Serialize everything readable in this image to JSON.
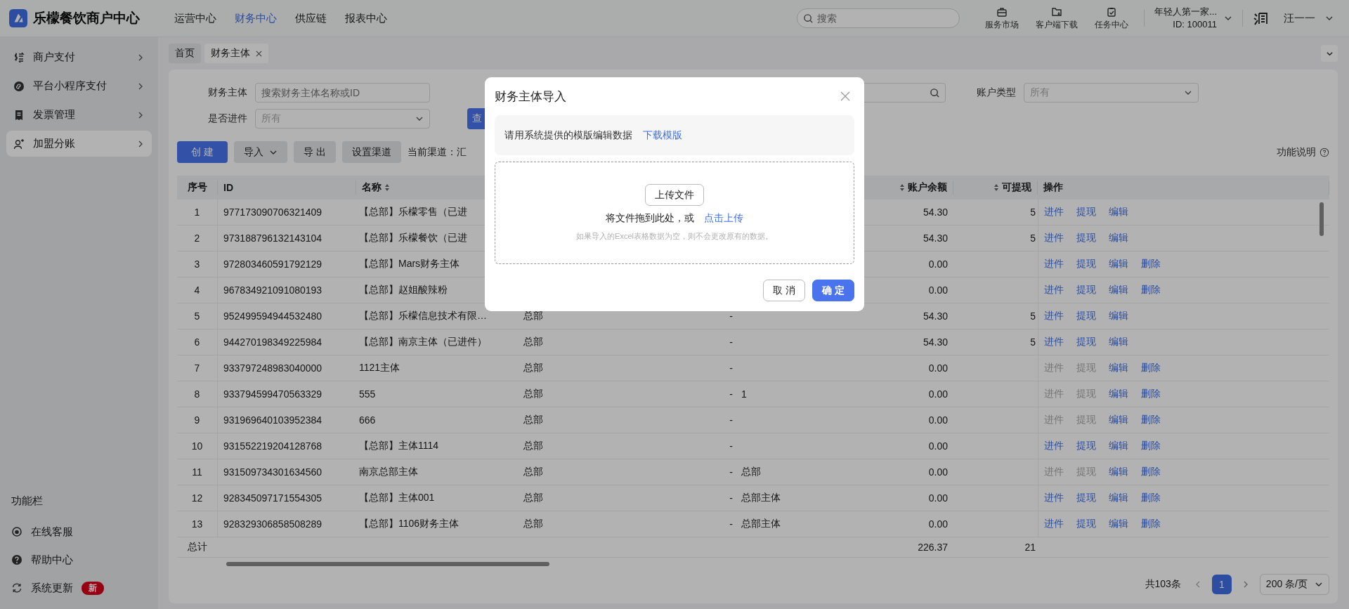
{
  "app": {
    "title": "乐檬餐饮商户中心"
  },
  "nav": [
    {
      "label": "运营中心",
      "selected": false
    },
    {
      "label": "财务中心",
      "selected": true
    },
    {
      "label": "供应链",
      "selected": false
    },
    {
      "label": "报表中心",
      "selected": false
    }
  ],
  "search": {
    "placeholder": "搜索"
  },
  "tools": [
    {
      "label": "服务市场",
      "kind": "shop"
    },
    {
      "label": "客户端下载",
      "kind": "download"
    },
    {
      "label": "任务中心",
      "kind": "task"
    }
  ],
  "account": {
    "name": "年轻人第一家...",
    "id": "ID: 100011"
  },
  "user": {
    "name": "汪一一"
  },
  "sidebar": {
    "items": [
      {
        "label": "商户支付",
        "kind": "exchange",
        "selected": false
      },
      {
        "label": "平台小程序支付",
        "kind": "miniapp",
        "selected": false
      },
      {
        "label": "发票管理",
        "kind": "invoice",
        "selected": false
      },
      {
        "label": "加盟分账",
        "kind": "person",
        "selected": true
      }
    ],
    "section_title": "功能栏",
    "footer_items": [
      {
        "label": "在线客服",
        "kind": "service"
      },
      {
        "label": "帮助中心",
        "kind": "help"
      },
      {
        "label": "系统更新",
        "kind": "update",
        "badge": "新"
      }
    ]
  },
  "tabs": [
    {
      "label": "首页",
      "selected": false,
      "closable": false
    },
    {
      "label": "财务主体",
      "selected": true,
      "closable": true
    }
  ],
  "filter_rows": [
    [
      {
        "label": "财务主体",
        "kind": "input",
        "placeholder": "搜索财务主体名称或ID"
      },
      {
        "kind": "search"
      },
      {
        "label": "账户类型",
        "kind": "select",
        "placeholder": "所有"
      }
    ],
    [
      {
        "label": "是否进件",
        "kind": "select",
        "placeholder": "所有"
      }
    ]
  ],
  "query_button": {
    "label": "查"
  },
  "toolbar": {
    "buttons": [
      {
        "label": "创 建",
        "kind": "primary"
      },
      {
        "label": "导入",
        "kind": "dropdown"
      },
      {
        "label": "导 出",
        "kind": "default"
      },
      {
        "label": "设置渠道",
        "kind": "default"
      }
    ],
    "channel": "当前渠道：汇",
    "help": "功能说明"
  },
  "table": {
    "columns": [
      {
        "label": "序号",
        "sortable": false
      },
      {
        "label": "ID",
        "sortable": false
      },
      {
        "label": "名称",
        "sortable": true
      },
      {
        "label": "账户余额",
        "sortable": true
      },
      {
        "label": "可提现",
        "sortable": true
      },
      {
        "label": "操作",
        "sortable": false
      }
    ],
    "rows": [
      {
        "no": "1",
        "id": "977173090706321409",
        "name": "【总部】乐檬零售（已进",
        "balance": "54.30",
        "withdrawable": "5",
        "actions": [
          {
            "label": "进件",
            "disabled": false
          },
          {
            "label": "提现",
            "disabled": false
          },
          {
            "label": "编辑",
            "disabled": false
          }
        ]
      },
      {
        "no": "2",
        "id": "973188796132143104",
        "name": "【总部】乐檬餐饮（已进",
        "balance": "54.30",
        "withdrawable": "5",
        "actions": [
          {
            "label": "进件",
            "disabled": false
          },
          {
            "label": "提现",
            "disabled": false
          },
          {
            "label": "编辑",
            "disabled": false
          }
        ]
      },
      {
        "no": "3",
        "id": "972803460591792129",
        "name": "【总部】Mars财务主体",
        "balance": "0.00",
        "actions": [
          {
            "label": "进件",
            "disabled": false
          },
          {
            "label": "提现",
            "disabled": false
          },
          {
            "label": "编辑",
            "disabled": false
          },
          {
            "label": "删除",
            "disabled": false
          }
        ]
      },
      {
        "no": "4",
        "id": "967834921091080193",
        "name": "【总部】赵姐酸辣粉",
        "balance": "0.00",
        "actions": [
          {
            "label": "进件",
            "disabled": false
          },
          {
            "label": "提现",
            "disabled": false
          },
          {
            "label": "编辑",
            "disabled": false
          },
          {
            "label": "删除",
            "disabled": false
          }
        ]
      },
      {
        "no": "5",
        "id": "952499594944532480",
        "name": "【总部】乐檬信息技术有限…",
        "column_4": "总部",
        "column_5": "-",
        "balance": "54.30",
        "withdrawable": "5",
        "actions": [
          {
            "label": "进件",
            "disabled": false
          },
          {
            "label": "提现",
            "disabled": false
          },
          {
            "label": "编辑",
            "disabled": false
          }
        ]
      },
      {
        "no": "6",
        "id": "944270198349225984",
        "name": "【总部】南京主体（已进件）",
        "column_4": "总部",
        "column_5": "-",
        "balance": "54.30",
        "withdrawable": "5",
        "actions": [
          {
            "label": "进件",
            "disabled": false
          },
          {
            "label": "提现",
            "disabled": false
          },
          {
            "label": "编辑",
            "disabled": false
          }
        ]
      },
      {
        "no": "7",
        "id": "933797248983040000",
        "name": "1121主体",
        "column_4": "总部",
        "column_5": "-",
        "balance": "0.00",
        "actions": [
          {
            "label": "进件",
            "disabled": true
          },
          {
            "label": "提现",
            "disabled": true
          },
          {
            "label": "编辑",
            "disabled": false
          },
          {
            "label": "删除",
            "disabled": false
          }
        ]
      },
      {
        "no": "8",
        "id": "933794599470563329",
        "name": "555",
        "column_4": "总部",
        "column_5": "-",
        "column_6": "1",
        "balance": "0.00",
        "actions": [
          {
            "label": "进件",
            "disabled": true
          },
          {
            "label": "提现",
            "disabled": true
          },
          {
            "label": "编辑",
            "disabled": false
          },
          {
            "label": "删除",
            "disabled": false
          }
        ]
      },
      {
        "no": "9",
        "id": "931969640103952384",
        "name": "666",
        "column_4": "总部",
        "column_5": "-",
        "balance": "0.00",
        "actions": [
          {
            "label": "进件",
            "disabled": true
          },
          {
            "label": "提现",
            "disabled": true
          },
          {
            "label": "编辑",
            "disabled": false
          },
          {
            "label": "删除",
            "disabled": false
          }
        ]
      },
      {
        "no": "10",
        "id": "931552219204128768",
        "name": "【总部】主体1114",
        "column_4": "总部",
        "column_5": "-",
        "balance": "0.00",
        "actions": [
          {
            "label": "进件",
            "disabled": false
          },
          {
            "label": "提现",
            "disabled": false
          },
          {
            "label": "编辑",
            "disabled": false
          },
          {
            "label": "删除",
            "disabled": false
          }
        ]
      },
      {
        "no": "11",
        "id": "931509734301634560",
        "name": "南京总部主体",
        "column_4": "总部",
        "column_5": "-",
        "column_6": "总部",
        "balance": "0.00",
        "actions": [
          {
            "label": "进件",
            "disabled": true
          },
          {
            "label": "提现",
            "disabled": true
          },
          {
            "label": "编辑",
            "disabled": false
          },
          {
            "label": "删除",
            "disabled": false
          }
        ]
      },
      {
        "no": "12",
        "id": "928345097171554305",
        "name": "【总部】主体001",
        "column_4": "总部",
        "column_5": "-",
        "column_6": "总部主体",
        "balance": "0.00",
        "actions": [
          {
            "label": "进件",
            "disabled": false
          },
          {
            "label": "提现",
            "disabled": false
          },
          {
            "label": "编辑",
            "disabled": false
          },
          {
            "label": "删除",
            "disabled": false
          }
        ]
      },
      {
        "no": "13",
        "id": "928329306858508289",
        "name": "【总部】1106财务主体",
        "column_4": "总部",
        "column_5": "-",
        "column_6": "总部主体",
        "balance": "0.00",
        "actions": [
          {
            "label": "进件",
            "disabled": false
          },
          {
            "label": "提现",
            "disabled": false
          },
          {
            "label": "编辑",
            "disabled": false
          },
          {
            "label": "删除",
            "disabled": false
          }
        ]
      }
    ],
    "total": {
      "label": "总计",
      "balance": "226.37",
      "withdrawable": "21"
    }
  },
  "pagination": {
    "total": "共103条",
    "pages": [
      {
        "label": "1",
        "selected": true
      }
    ],
    "page_size": "200 条/页"
  },
  "dialog": {
    "title": "财务主体导入",
    "notice": "请用系统提供的模版编辑数据",
    "download_link": "下载模版",
    "upload_button": "上传文件",
    "drop_text": "将文件拖到此处，或",
    "upload_link": "点击上传",
    "hint": "如果导入的Excel表格数据为空，则不会更改原有的数据。",
    "buttons": [
      {
        "label": "取 消",
        "kind": "default"
      },
      {
        "label": "确 定",
        "kind": "primary"
      }
    ]
  }
}
